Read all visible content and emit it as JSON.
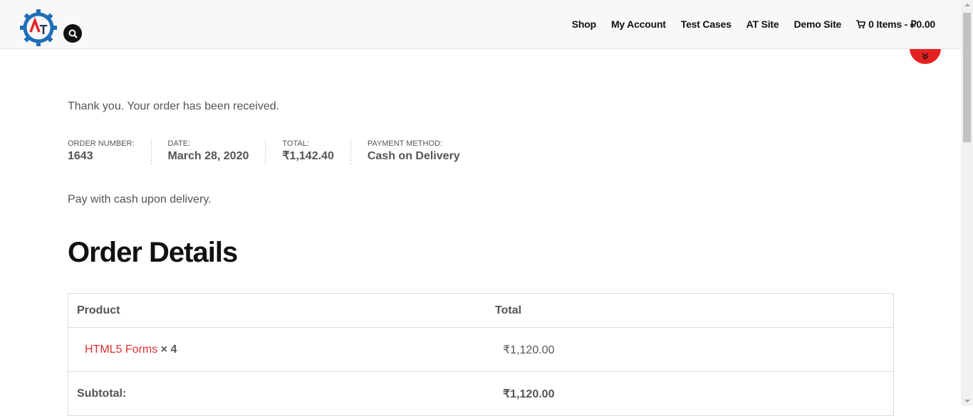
{
  "header": {
    "logo_letters": "AT",
    "nav": [
      "Shop",
      "My Account",
      "Test Cases",
      "AT Site",
      "Demo Site"
    ],
    "cart_label": "0 Items - ₽0.00"
  },
  "order": {
    "thank_you": "Thank you. Your order has been received.",
    "overview": [
      {
        "label": "Order number:",
        "value": "1643"
      },
      {
        "label": "Date:",
        "value": "March 28, 2020"
      },
      {
        "label": "Total:",
        "value": "₹1,142.40"
      },
      {
        "label": "Payment method:",
        "value": "Cash on Delivery"
      }
    ],
    "payment_note": "Pay with cash upon delivery."
  },
  "details": {
    "heading": "Order Details",
    "columns": [
      "Product",
      "Total"
    ],
    "items": [
      {
        "name": "HTML5 Forms",
        "qty": "× 4",
        "total": "₹1,120.00"
      }
    ],
    "subtotal_label": "Subtotal:",
    "subtotal_value": "₹1,120.00"
  },
  "colors": {
    "accent": "#e52222",
    "link": "#d9312d",
    "logo_blue": "#1e6fb8"
  }
}
